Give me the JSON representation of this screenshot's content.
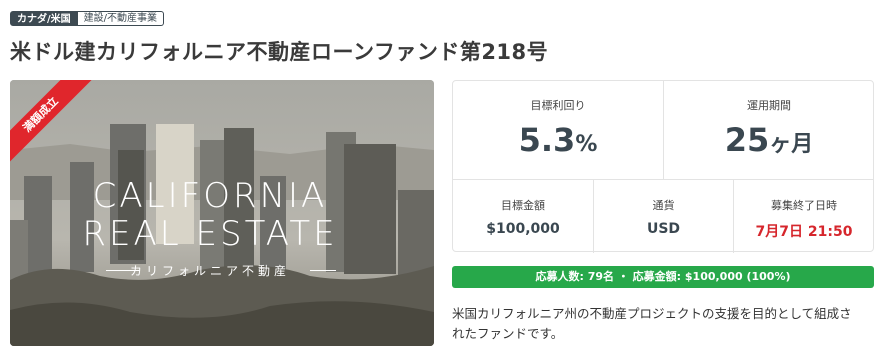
{
  "tags": {
    "region": "カナダ/米国",
    "category": "建設/不動産事業"
  },
  "title": "米ドル建カリフォルニア不動産ローンファンド第218号",
  "hero": {
    "ribbon": "満額成立",
    "line1": "CALIFORNIA",
    "line2": "REAL ESTATE",
    "line3": "カリフォルニア不動産"
  },
  "stats": {
    "yield": {
      "label": "目標利回り",
      "value": "5.3",
      "unit": "%"
    },
    "term": {
      "label": "運用期間",
      "value": "25",
      "unit": "ヶ月"
    },
    "target": {
      "label": "目標金額",
      "value": "$100,000"
    },
    "currency": {
      "label": "通貨",
      "value": "USD"
    },
    "deadline": {
      "label": "募集終了日時",
      "value": "7月7日 21:50"
    }
  },
  "progress": {
    "text": "応募人数: 79名 ・ 応募金額: $100,000 (100%)",
    "percent": 100,
    "color": "#27a84a"
  },
  "description": "米国カリフォルニア州の不動産プロジェクトの支援を目的として組成されたファンドです。"
}
